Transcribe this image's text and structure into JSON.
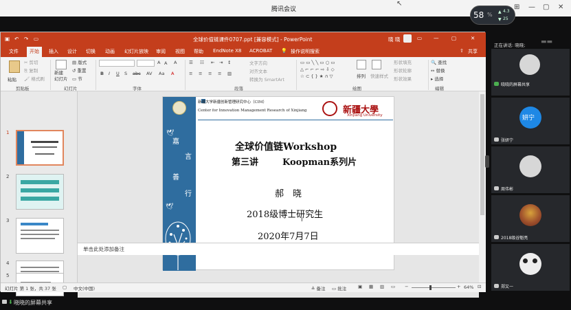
{
  "window": {
    "title": "腾讯会议",
    "network_pct": "58",
    "net_up": "4.3",
    "net_down": "25"
  },
  "ppt": {
    "title": "全球价值链课件0707.ppt [兼容模式] - PowerPoint",
    "user": "晓 晓",
    "share_label": "共享",
    "tabs": [
      "文件",
      "开始",
      "插入",
      "设计",
      "切换",
      "动画",
      "幻灯片放映",
      "审阅",
      "视图",
      "帮助",
      "EndNote X8",
      "ACROBAT",
      "操作说明搜索"
    ],
    "ribbon": {
      "paste": "粘贴",
      "cut": "剪切",
      "copy": "复制",
      "format_painter": "格式刷",
      "clipboard_group": "剪贴板",
      "new_slide": "新建\n幻灯片",
      "layout": "版式",
      "reset": "重置",
      "section": "节",
      "slides_group": "幻灯片",
      "font_group": "字体",
      "paragraph_group": "段落",
      "text_direction": "文字方向",
      "align_text": "对齐文本",
      "smartart": "转换为 SmartArt",
      "drawing_group": "绘图",
      "arrange": "排列",
      "quick_styles": "快速样式",
      "shape_fill": "形状填充",
      "shape_outline": "形状轮廓",
      "shape_effects": "形状效果",
      "find": "查找",
      "replace": "替换",
      "select": "选择",
      "editing_group": "编辑"
    },
    "slide": {
      "header_cn": "新疆大学新疆创新管理研究中心（CIM）",
      "header_en": "Center for Innovation Management Research of Xinjiang",
      "univ_cn": "新疆大學",
      "univ_en": "Xinjiang University",
      "vertical_words": [
        "嘉",
        "言",
        "善",
        "行"
      ],
      "title_line1": "全球价值链Workshop",
      "title_line2_a": "第三讲",
      "title_line2_b": "Koopman系列片",
      "author": "郝　晓",
      "program": "2018级博士研究生",
      "date": "2020年7月7日"
    },
    "thumbnails": [
      "1",
      "2",
      "3",
      "4",
      "5"
    ],
    "notes_placeholder": "单击此处添加备注",
    "status": {
      "slide_info": "幻灯片 第 1 张，共 37 张",
      "language": "中文(中国)",
      "notes": "备注",
      "comments": "批注",
      "zoom": "64%"
    }
  },
  "meeting": {
    "speaking": "正在讲话: 晓晓;",
    "participants": [
      {
        "name": "晓晓的屏幕共享",
        "avatar_text": ""
      },
      {
        "name": "张妍宁",
        "avatar_text": "妍宁"
      },
      {
        "name": "周伟彬",
        "avatar_text": ""
      },
      {
        "name": "2018级谷魁亮",
        "avatar_text": ""
      },
      {
        "name": "郑又一",
        "avatar_text": ""
      }
    ],
    "bottom_share": "晓晓的屏幕共享"
  }
}
